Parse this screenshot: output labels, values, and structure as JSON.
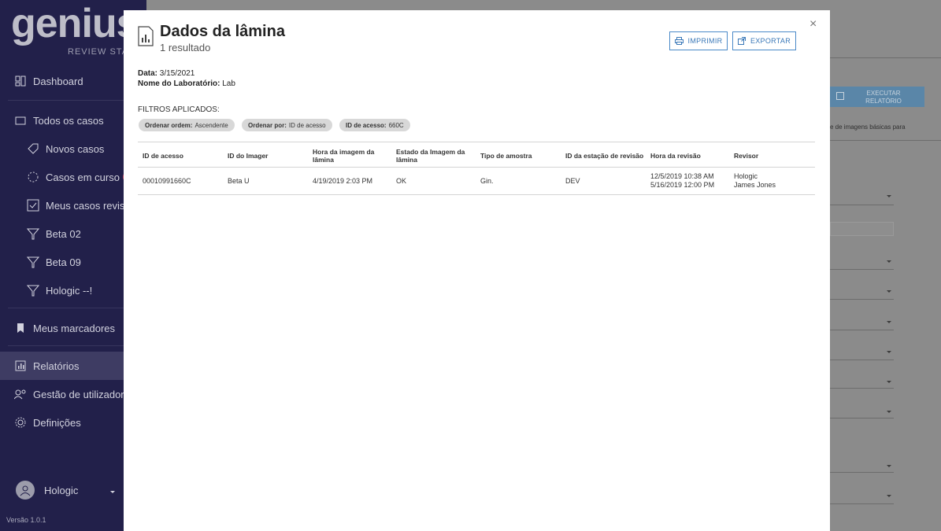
{
  "app": {
    "logo_text": "genius",
    "logo_subtitle": "REVIEW STATIC",
    "version": "Versão 1.0.1",
    "user_name": "Hologic"
  },
  "sidebar": {
    "items": [
      {
        "label": "Dashboard",
        "icon": "dashboard-icon"
      },
      {
        "label": "Todos os casos",
        "icon": "folder-icon"
      },
      {
        "label": "Novos casos",
        "icon": "tag-icon"
      },
      {
        "label": "Casos em curso",
        "icon": "progress-icon"
      },
      {
        "label": "Meus casos revisto",
        "icon": "checkbox-icon"
      },
      {
        "label": "Beta 02",
        "icon": "filter-icon"
      },
      {
        "label": "Beta 09",
        "icon": "filter-icon"
      },
      {
        "label": "Hologic --!",
        "icon": "filter-icon"
      },
      {
        "label": "Meus marcadores",
        "icon": "bookmark-icon"
      },
      {
        "label": "Relatórios",
        "icon": "report-icon"
      },
      {
        "label": "Gestão de utilizadore",
        "icon": "users-icon"
      },
      {
        "label": "Definições",
        "icon": "gear-icon"
      }
    ]
  },
  "background": {
    "run_button": "EXECUTAR RELATÓRIO",
    "description_fragment": "e de imagens básicas para"
  },
  "modal": {
    "title": "Dados da lâmina",
    "result_count": "1 resultado",
    "print_label": "IMPRIMIR",
    "export_label": "EXPORTAR",
    "close_label": "×",
    "date_label": "Data:",
    "date_value": "3/15/2021",
    "lab_label": "Nome do Laboratório:",
    "lab_value": "Lab",
    "filters_heading": "FILTROS APLICADOS:",
    "filters": [
      {
        "key": "Ordenar ordem:",
        "value": "Ascendente"
      },
      {
        "key": "Ordenar por:",
        "value": "ID de acesso"
      },
      {
        "key": "ID de acesso:",
        "value": "660C"
      }
    ],
    "table": {
      "headers": [
        "ID de acesso",
        "ID do Imager",
        "Hora da imagem da lâmina",
        "Estado da Imagem da lâmina",
        "Tipo de amostra",
        "ID da estação de revisão",
        "Hora da revisão",
        "Revisor"
      ],
      "rows": [
        [
          "00010991660C",
          "Beta U",
          "4/19/2019 2:03 PM",
          "OK",
          "Gin.",
          "DEV",
          "12/5/2019 10:38 AM\n5/16/2019 12:00 PM",
          "Hologic\nJames Jones"
        ]
      ]
    }
  }
}
